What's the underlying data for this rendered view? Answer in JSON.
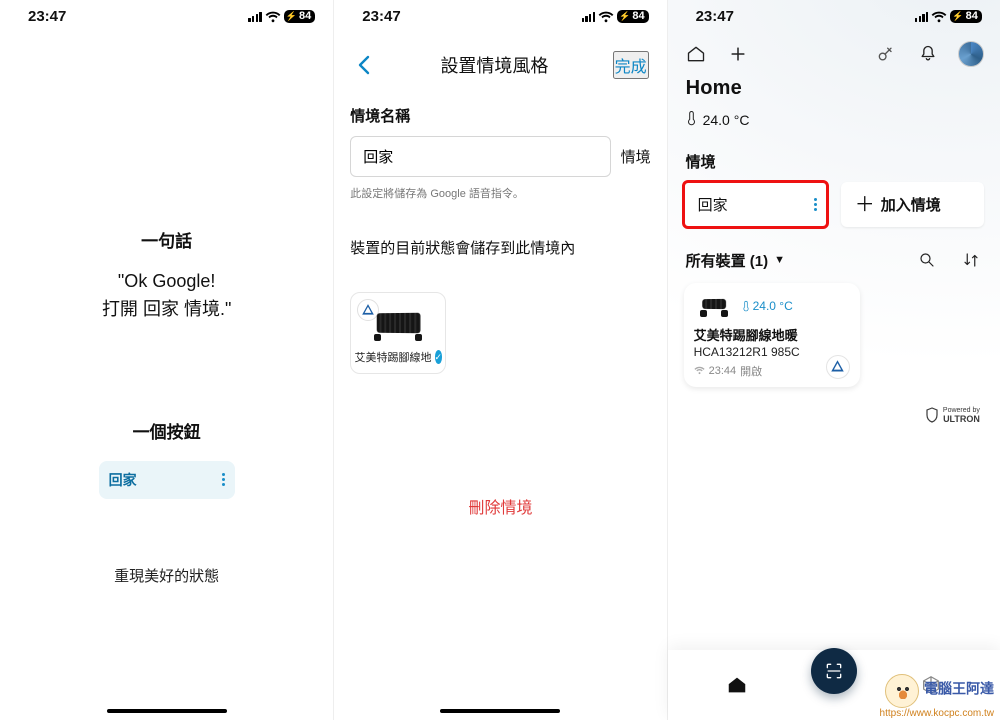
{
  "status": {
    "time": "23:47",
    "battery": "84"
  },
  "phone1": {
    "heading1": "一句話",
    "quote_line1": "\"Ok Google!",
    "quote_line2": "打開 回家 情境.\"",
    "heading2": "一個按鈕",
    "chip_label": "回家",
    "footer": "重現美好的狀態"
  },
  "phone2": {
    "title": "設置情境風格",
    "done": "完成",
    "field_label": "情境名稱",
    "input_value": "回家",
    "input_suffix": "情境",
    "help_text": "此設定將儲存為 Google 語音指令。",
    "section_desc": "裝置的目前狀態會儲存到此情境內",
    "device_name": "艾美特踢腳線地",
    "delete": "刪除情境"
  },
  "phone3": {
    "home_title": "Home",
    "temp": "24.0 °C",
    "scenes_head": "情境",
    "scene1": "回家",
    "add_scene": "加入情境",
    "devices_head": "所有裝置 (1)",
    "device": {
      "temp": "24.0 °C",
      "name": "艾美特踢腳線地暖",
      "model": "HCA13212R1 985C",
      "status_time": "23:44",
      "status_state": "開啟"
    },
    "powered_top": "Powered by",
    "powered_brand": "ULTRON"
  },
  "watermark": {
    "line1": "電腦王阿達",
    "line2": "https://www.kocpc.com.tw"
  }
}
